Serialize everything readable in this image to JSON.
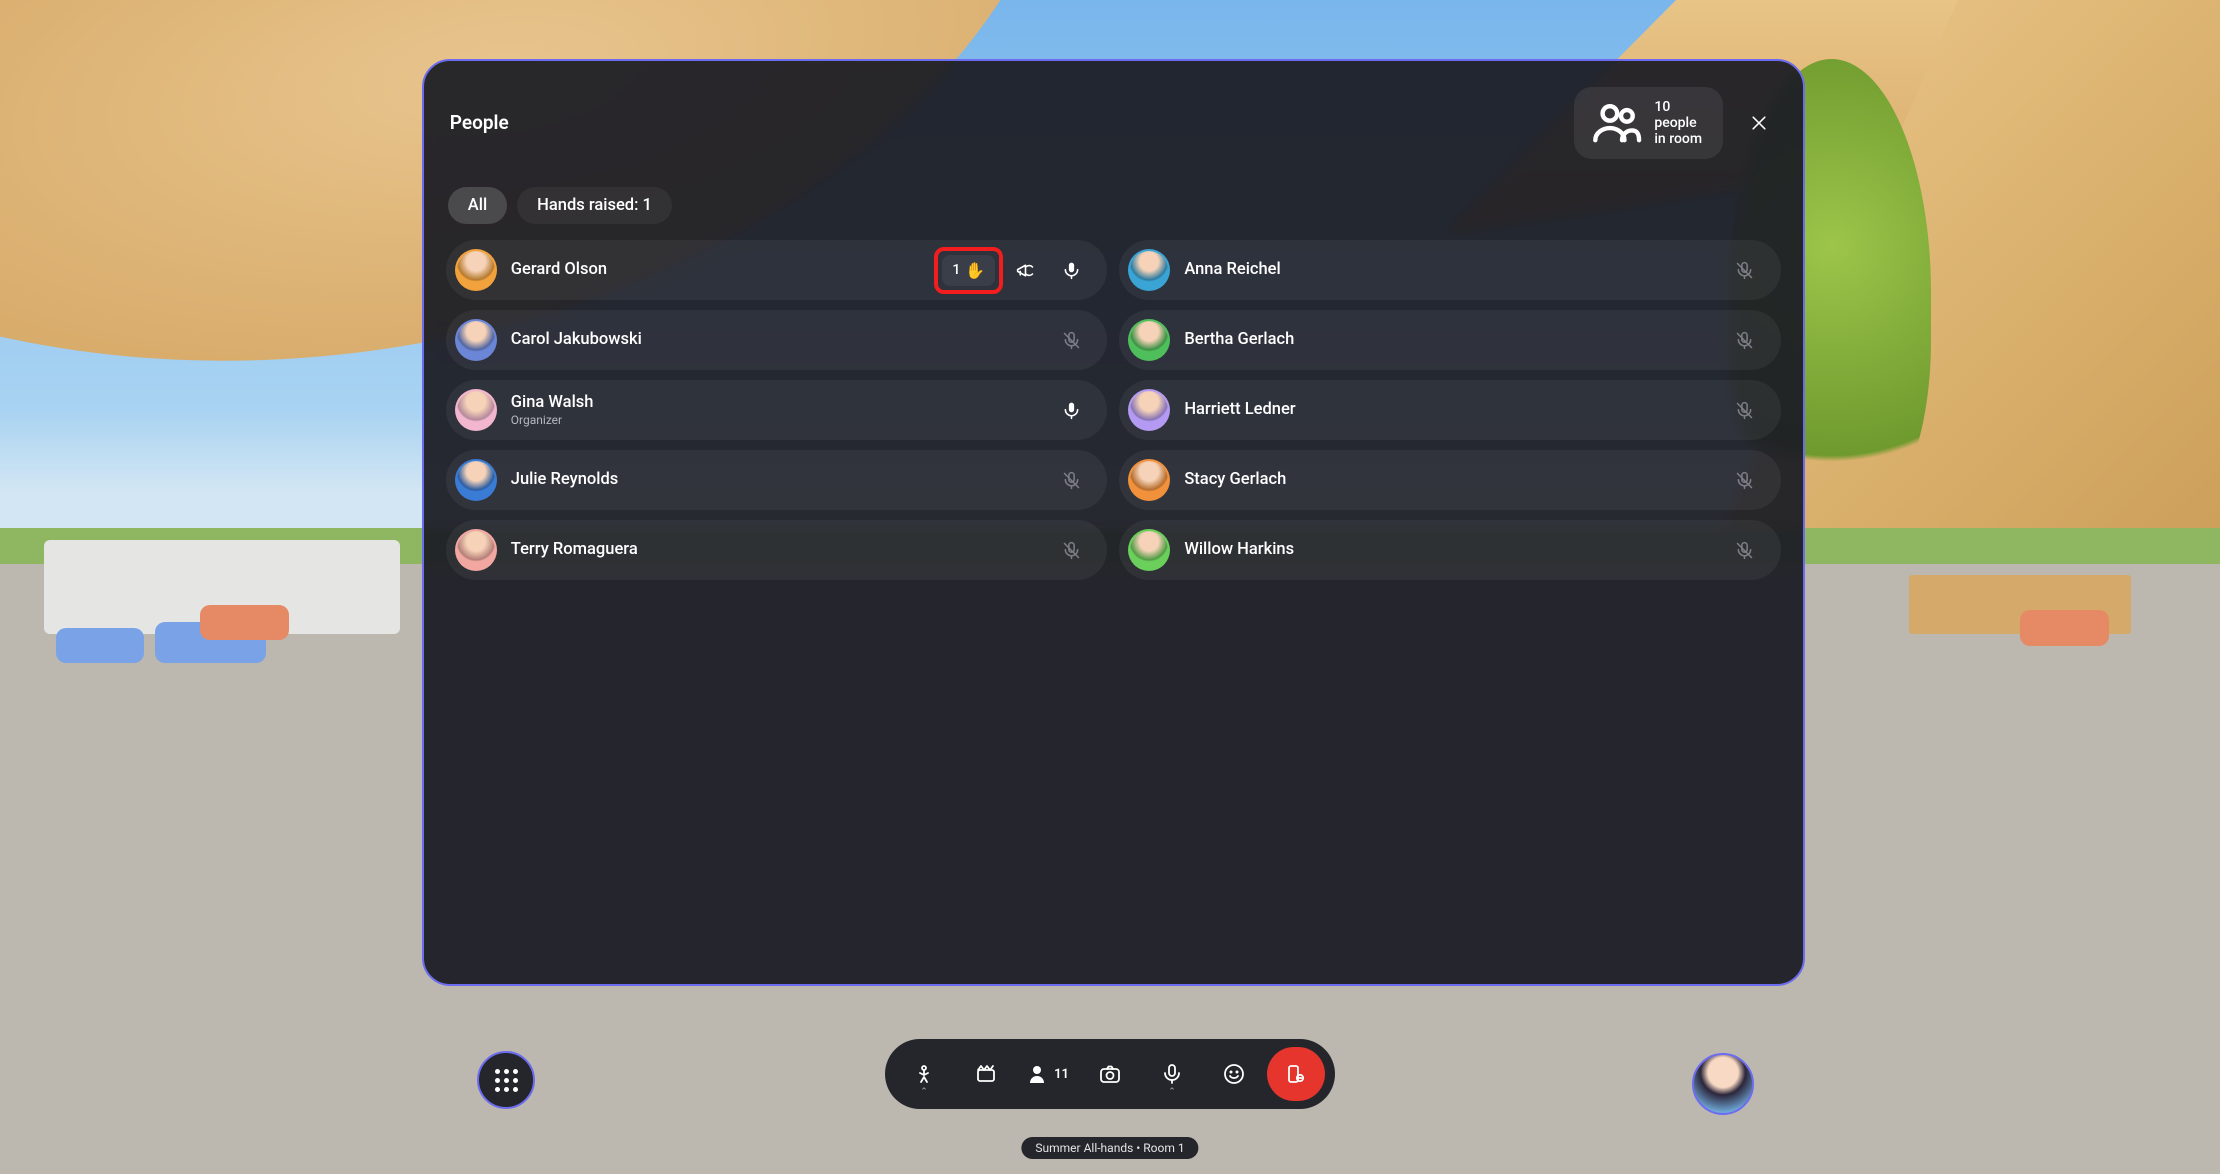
{
  "panel": {
    "title": "People",
    "room_count_label": "10 people in room",
    "tabs": {
      "all": "All",
      "hands_raised": "Hands raised: 1"
    }
  },
  "people": {
    "left": [
      {
        "name": "Gerard Olson",
        "role": "",
        "avatar_bg": "#f2a23c",
        "mic": "on",
        "hand_order": "1",
        "megaphone": true
      },
      {
        "name": "Carol Jakubowski",
        "role": "",
        "avatar_bg": "#6b86d6",
        "mic": "muted"
      },
      {
        "name": "Gina Walsh",
        "role": "Organizer",
        "avatar_bg": "#f2b6cf",
        "mic": "on"
      },
      {
        "name": "Julie Reynolds",
        "role": "",
        "avatar_bg": "#3a7bd5",
        "mic": "muted"
      },
      {
        "name": "Terry Romaguera",
        "role": "",
        "avatar_bg": "#f2a8a1",
        "mic": "muted"
      }
    ],
    "right": [
      {
        "name": "Anna Reichel",
        "role": "",
        "avatar_bg": "#3aa4d5",
        "mic": "muted"
      },
      {
        "name": "Bertha Gerlach",
        "role": "",
        "avatar_bg": "#4fbf5b",
        "mic": "muted"
      },
      {
        "name": "Harriett Ledner",
        "role": "",
        "avatar_bg": "#b49af2",
        "mic": "muted"
      },
      {
        "name": "Stacy Gerlach",
        "role": "",
        "avatar_bg": "#f2913c",
        "mic": "muted"
      },
      {
        "name": "Willow Harkins",
        "role": "",
        "avatar_bg": "#6bcf5b",
        "mic": "muted"
      }
    ]
  },
  "toolbar": {
    "participants_count": "11"
  },
  "footer": {
    "room_label": "Summer All-hands • Room 1"
  }
}
